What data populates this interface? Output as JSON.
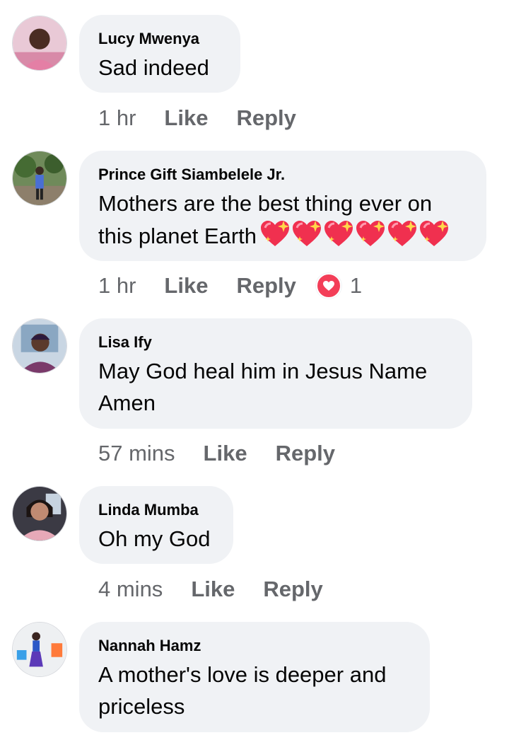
{
  "comments": [
    {
      "author": "Lucy Mwenya",
      "text": "Sad indeed",
      "time": "1 hr",
      "like": "Like",
      "reply": "Reply"
    },
    {
      "author": "Prince Gift Siambelele Jr.",
      "text": "Mothers are the best thing ever on this planet Earth",
      "emoji": "sparkling-heart x6",
      "time": "1 hr",
      "like": "Like",
      "reply": "Reply",
      "reaction": {
        "icon": "love-icon",
        "count": "1",
        "color": "#f33e58"
      }
    },
    {
      "author": "Lisa Ify",
      "text": "May God heal him in Jesus Name Amen",
      "time": "57 mins",
      "like": "Like",
      "reply": "Reply"
    },
    {
      "author": "Linda Mumba",
      "text": "Oh my God",
      "time": "4 mins",
      "like": "Like",
      "reply": "Reply"
    },
    {
      "author": "Nannah Hamz",
      "text": "A mother's love is deeper and priceless"
    }
  ],
  "colors": {
    "bubble": "#f0f2f5",
    "meta": "#65676b",
    "text": "#050505"
  }
}
